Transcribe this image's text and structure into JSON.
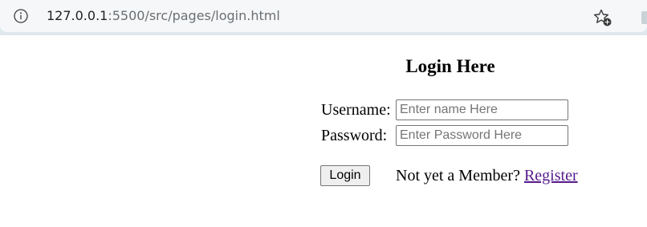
{
  "browser": {
    "url_host": "127.0.0.1",
    "url_path": ":5500/src/pages/login.html",
    "info_icon": "info-icon",
    "favorites_icon": "add-favorite-icon"
  },
  "page": {
    "title": "Login Here",
    "username_label": "Username:",
    "username_placeholder": "Enter name Here",
    "password_label": "Password:",
    "password_placeholder": "Enter Password Here",
    "login_button": "Login",
    "member_prompt": "Not yet a Member?",
    "register_link": "Register"
  },
  "colors": {
    "link_visited": "#551a8b"
  }
}
